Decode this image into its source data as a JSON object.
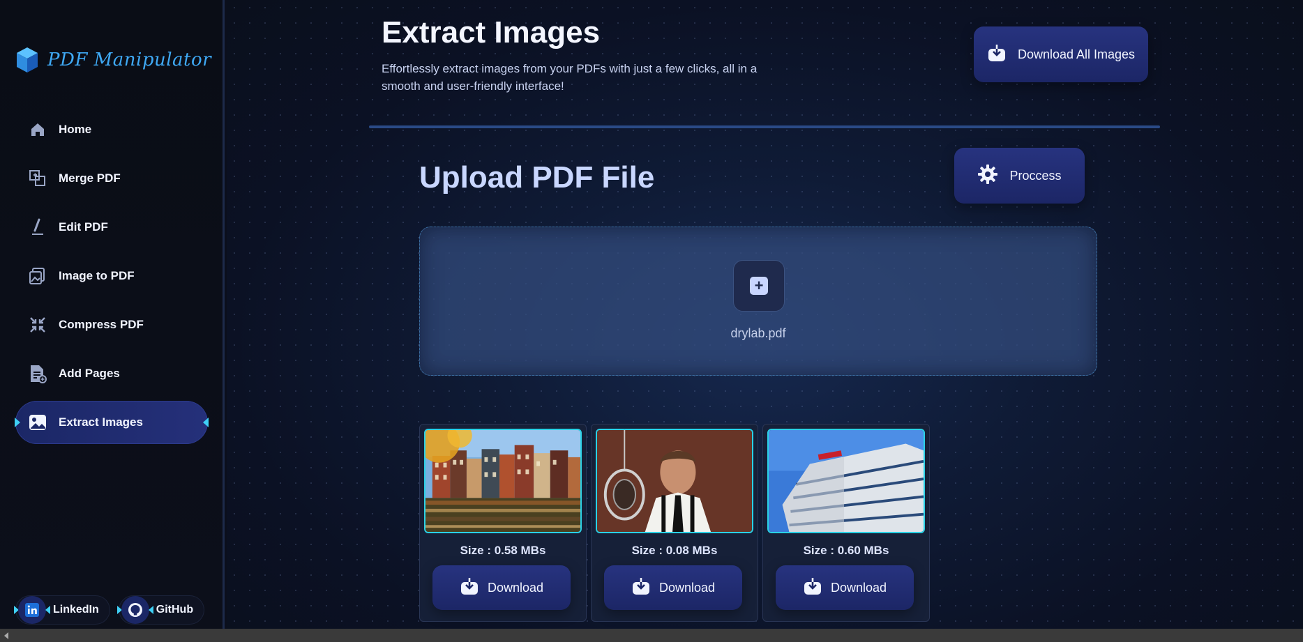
{
  "brand": {
    "name": "PDF Manipulator"
  },
  "nav": {
    "items": [
      {
        "label": "Home",
        "icon": "home-icon"
      },
      {
        "label": "Merge PDF",
        "icon": "merge-icon"
      },
      {
        "label": "Edit PDF",
        "icon": "edit-icon"
      },
      {
        "label": "Image to PDF",
        "icon": "image-to-pdf-icon"
      },
      {
        "label": "Compress PDF",
        "icon": "compress-icon"
      },
      {
        "label": "Add Pages",
        "icon": "add-pages-icon"
      },
      {
        "label": "Extract Images",
        "icon": "extract-images-icon",
        "active": true
      }
    ]
  },
  "social": {
    "linkedin": "LinkedIn",
    "github": "GitHub"
  },
  "header": {
    "title": "Extract Images",
    "subtitle": "Effortlessly extract images from your PDFs with just a few clicks, all in a smooth and user-friendly interface!",
    "download_all_label": "Download All Images"
  },
  "upload": {
    "title": "Upload PDF File",
    "process_label": "Proccess",
    "file_name": "drylab.pdf"
  },
  "images": [
    {
      "size": "Size : 0.58 MBs",
      "download_label": "Download",
      "subject": "canal-houses"
    },
    {
      "size": "Size : 0.08 MBs",
      "download_label": "Download",
      "subject": "man-at-microphone"
    },
    {
      "size": "Size : 0.60 MBs",
      "download_label": "Download",
      "subject": "office-building"
    }
  ],
  "colors": {
    "accent": "#3fd0f5",
    "brand": "#3fa9f5",
    "button": "#1c2666"
  }
}
